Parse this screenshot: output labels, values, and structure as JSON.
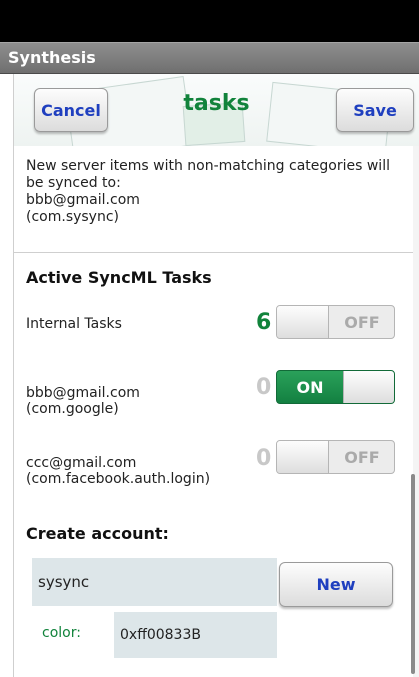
{
  "app_title": "Synthesis",
  "header": {
    "cancel_label": "Cancel",
    "title": "tasks",
    "save_label": "Save"
  },
  "info_text": {
    "line1": "New server items with non-matching categories will be synced to:",
    "account": "bbb@gmail.com",
    "account_type": "(com.sysync)"
  },
  "active_tasks": {
    "title": "Active SyncML Tasks",
    "rows": [
      {
        "label": "Internal Tasks",
        "sub": "",
        "count": "6",
        "toggle": "OFF"
      },
      {
        "label": "bbb@gmail.com",
        "sub": "(com.google)",
        "count": "0",
        "toggle": "ON"
      },
      {
        "label": "ccc@gmail.com",
        "sub": "(com.facebook.auth.login)",
        "count": "0",
        "toggle": "OFF"
      }
    ]
  },
  "create_account": {
    "title": "Create account:",
    "name_value": "sysync",
    "new_label": "New",
    "color_label": "color:",
    "color_value": "0xff00833B"
  },
  "colors": {
    "accent_green": "#11833b",
    "button_text_blue": "#1f3fbf",
    "toggle_on": "#1b8d4c",
    "field_background": "#dde6e9"
  }
}
